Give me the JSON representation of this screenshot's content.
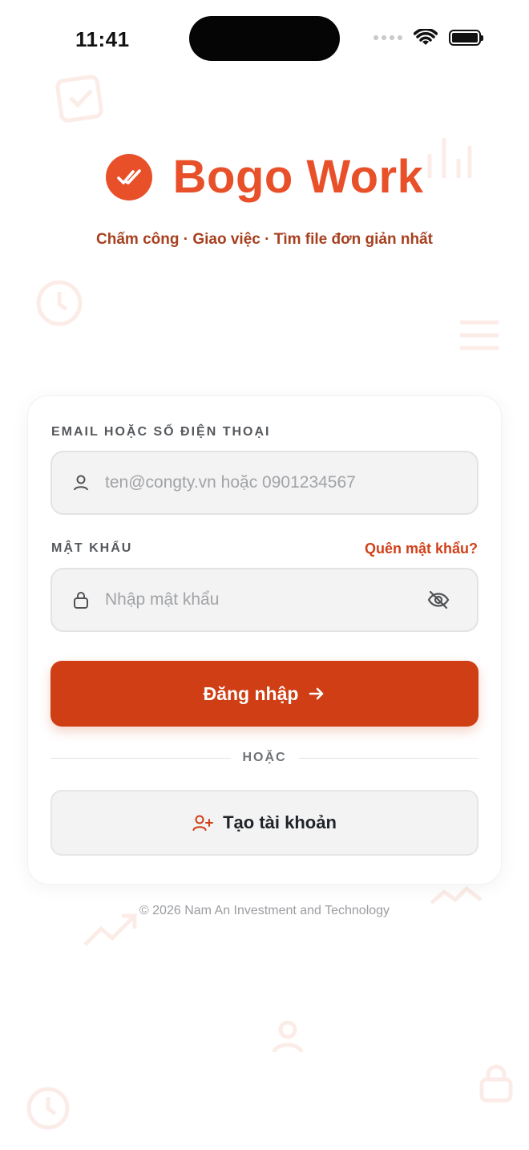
{
  "status_bar": {
    "time": "11:41"
  },
  "brand": {
    "app_name": "Bogo Work",
    "tagline": "Chấm công · Giao việc · Tìm file đơn giản nhất",
    "accent_color": "#e8502a",
    "logo_icon": "double-check-icon"
  },
  "login_form": {
    "email_label": "EMAIL HOẶC SỐ ĐIỆN THOẠI",
    "email_placeholder": "ten@congty.vn hoặc 0901234567",
    "email_value": "",
    "email_icon": "user-icon",
    "password_label": "MẬT KHẨU",
    "forgot_password": "Quên mật khẩu?",
    "password_placeholder": "Nhập mật khẩu",
    "password_value": "",
    "password_icon": "lock-icon",
    "visibility_icon": "eye-off-icon",
    "login_button": "Đăng nhập",
    "login_button_icon": "arrow-right-icon",
    "login_button_color": "#cf3e14",
    "divider_text": "HOẶC",
    "create_account_button": "Tạo tài khoản",
    "create_account_icon": "user-plus-icon"
  },
  "footer": {
    "copyright": "© 2026 Nam An Investment and Technology"
  }
}
